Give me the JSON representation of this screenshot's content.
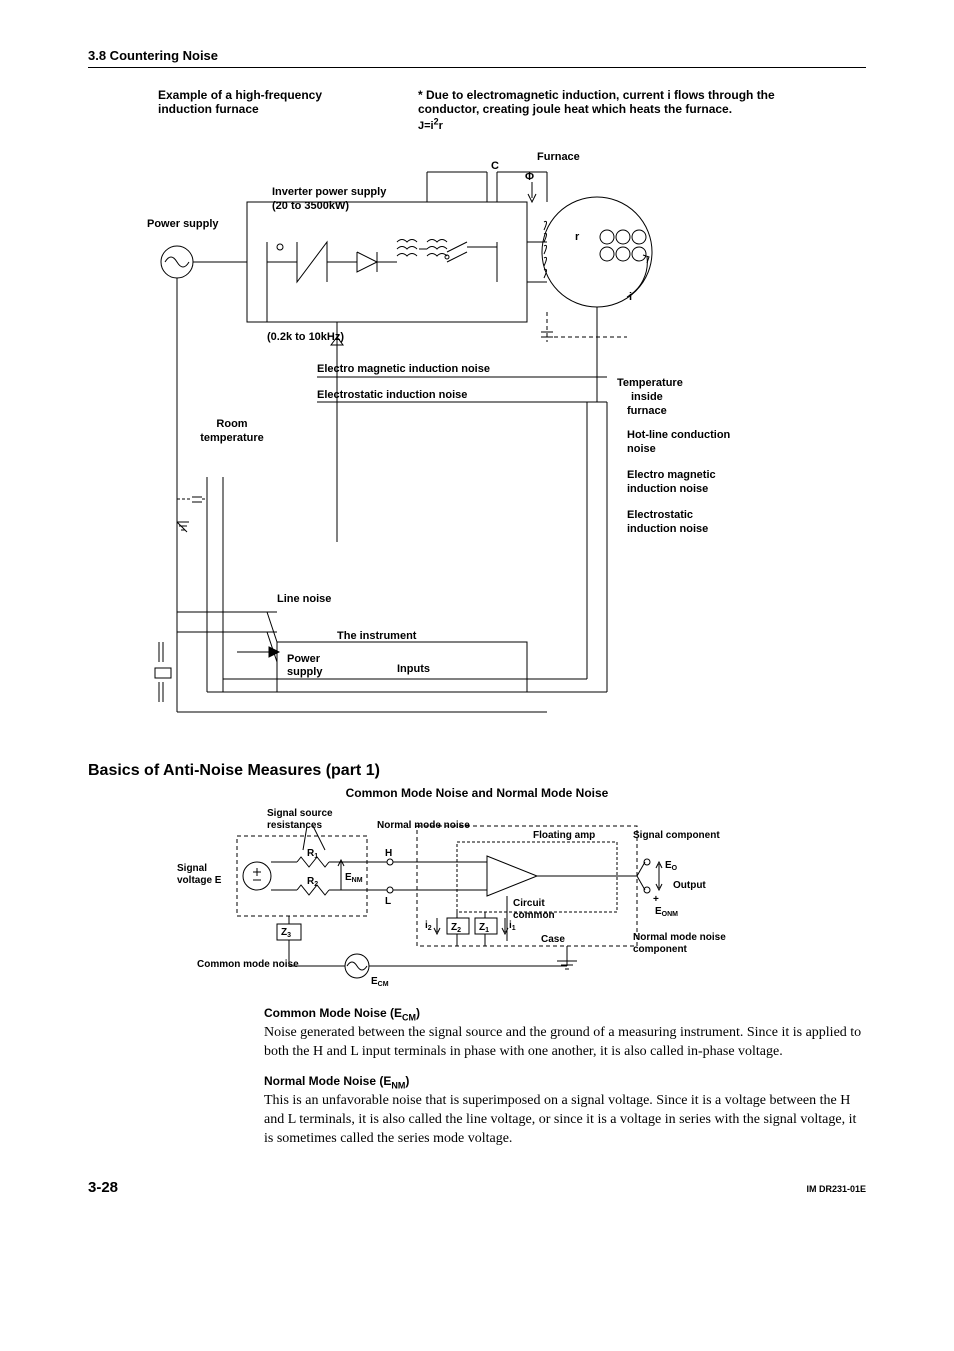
{
  "header": {
    "section": "3.8  Countering Noise"
  },
  "intro": {
    "left": "Example of a high-frequency induction furnace",
    "rightStar": "*  Due to electromagnetic induction, current i flows through the conductor, creating joule heat which heats the furnace.",
    "formula": "J=i",
    "formulaSup": "2",
    "formulaTail": "r"
  },
  "fig1": {
    "powerSupply": "Power supply",
    "inverter1": "Inverter power supply",
    "inverter2": "(20 to 3500kW)",
    "freq": "(0.2k to 10kHz)",
    "furnace": "Furnace",
    "c": "C",
    "phi": "Φ",
    "r": "r",
    "i": "i",
    "emNoise": "Electro magnetic induction noise",
    "esNoise": "Electrostatic induction noise",
    "roomTemp1": "Room",
    "roomTemp2": "temperature",
    "tempInside1": "Temperature",
    "tempInside2": "inside",
    "tempInside3": "furnace",
    "hotLine1": "Hot-line conduction",
    "hotLine2": "noise",
    "em2a": "Electro magnetic",
    "em2b": "induction noise",
    "es2a": "Electrostatic",
    "es2b": "induction noise",
    "lineNoise": "Line noise",
    "instr": "The instrument",
    "power2a": "Power",
    "power2b": "supply",
    "inputs": "Inputs"
  },
  "heading": "Basics of Anti-Noise Measures (part 1)",
  "subheading": "Common Mode Noise and Normal Mode Noise",
  "fig2": {
    "sigSrc1": "Signal source",
    "sigSrc2": "resistances",
    "sigV1": "Signal",
    "sigV2": "voltage E",
    "normMode": "Normal mode noise",
    "R1": "R1",
    "R2": "R2",
    "H": "H",
    "L": "L",
    "Enm": "ENM",
    "Z3": "Z3",
    "Z2": "Z2",
    "Z1": "Z1",
    "i1": "i1",
    "i2": "i2",
    "floatAmp": "Floating amp",
    "circuit1": "Circuit",
    "circuit2": "common",
    "caseL": "Case",
    "sigComp": "Signal component",
    "Eo": "EO",
    "plus": "+",
    "output": "Output",
    "Eonm": "EONM",
    "nmComp1": "Normal mode noise",
    "nmComp2": "component",
    "commonMode": "Common mode noise",
    "Ecm": "ECM"
  },
  "para1": {
    "head": "Common Mode Noise (E",
    "sub": "CM",
    "headTail": ")",
    "body": "Noise generated between the signal source and the ground of a measuring instrument. Since it is applied to both the H and L input terminals in phase with one another, it is also called in-phase voltage."
  },
  "para2": {
    "head": "Normal Mode Noise (E",
    "sub": "NM",
    "headTail": ")",
    "body": "This is an unfavorable noise that is superimposed on a signal voltage. Since it is a voltage between the H and L terminals, it is also called the line voltage, or since it is a voltage in series with the signal voltage, it is sometimes called the series mode voltage."
  },
  "footer": {
    "page": "3-28",
    "doc": "IM DR231-01E"
  }
}
